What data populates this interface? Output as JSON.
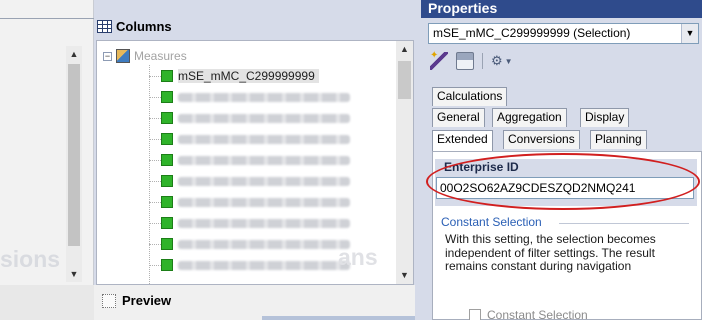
{
  "left_panel": {
    "ghost_text": "sions"
  },
  "columns": {
    "title": "Columns",
    "root_label": "Measures",
    "selected_item": "mSE_mMC_C299999999",
    "ghost_text": "ans"
  },
  "preview": {
    "title": "Preview"
  },
  "properties": {
    "title": "Properties",
    "selection_value": "mSE_mMC_C299999999 (Selection)",
    "tabs_row1": [
      "Calculations"
    ],
    "tabs_row2": [
      "General",
      "Aggregation",
      "Display"
    ],
    "tabs_row3": [
      "Extended",
      "Conversions",
      "Planning"
    ],
    "active_tab": "Extended",
    "enterprise_id_label": "Enterprise ID",
    "enterprise_id_value": "00O2SO62AZ9CDESZQD2NMQ241",
    "constant_selection_title": "Constant Selection",
    "constant_selection_desc": "With this setting, the selection becomes independent of filter settings. The result remains constant during navigation",
    "constant_selection_checkbox": "Constant Selection"
  },
  "colors": {
    "header_bg": "#2f4b8c",
    "highlight_ring": "#d11f1f",
    "measure_icon": "#2fb32a",
    "section_title": "#2a5fb5"
  }
}
